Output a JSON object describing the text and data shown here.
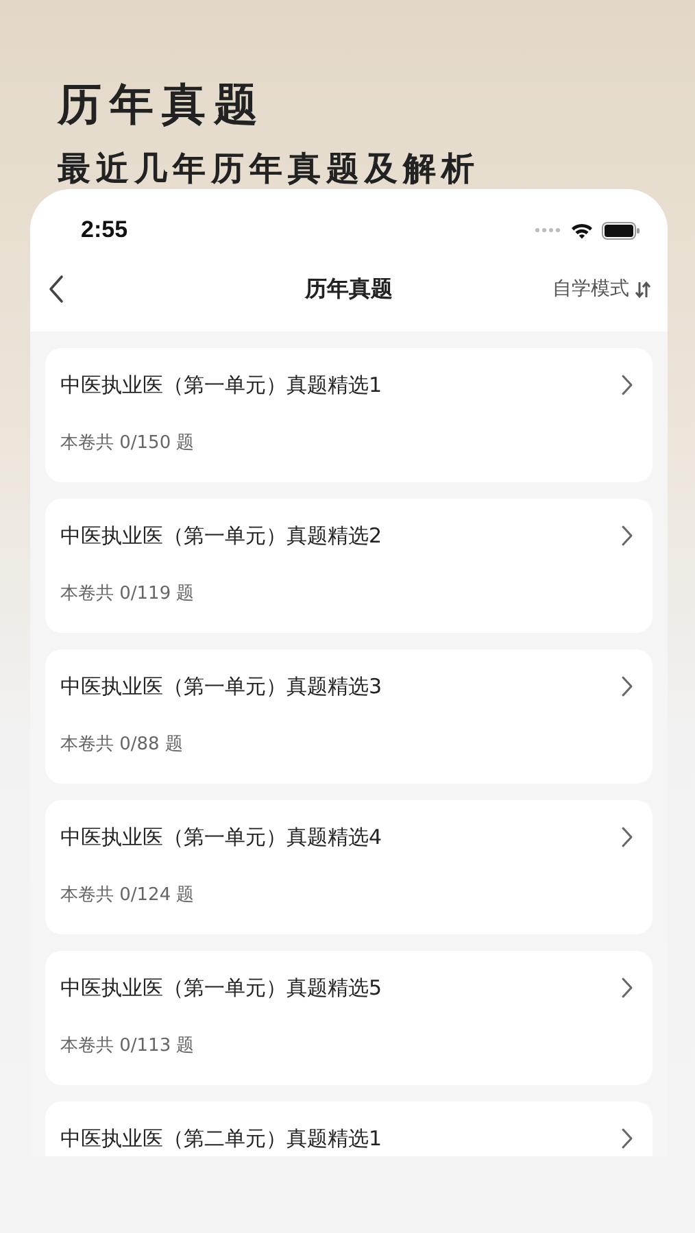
{
  "headline": {
    "title": "历年真题",
    "subtitle": "最近几年历年真题及解析"
  },
  "status_bar": {
    "time": "2:55"
  },
  "nav": {
    "title": "历年真题",
    "mode": "自学模式"
  },
  "papers": [
    {
      "title": "中医执业医（第一单元）真题精选1",
      "count": "本卷共 0/150 题"
    },
    {
      "title": "中医执业医（第一单元）真题精选2",
      "count": "本卷共 0/119 题"
    },
    {
      "title": "中医执业医（第一单元）真题精选3",
      "count": "本卷共 0/88 题"
    },
    {
      "title": "中医执业医（第一单元）真题精选4",
      "count": "本卷共 0/124 题"
    },
    {
      "title": "中医执业医（第一单元）真题精选5",
      "count": "本卷共 0/113 题"
    },
    {
      "title": "中医执业医（第二单元）真题精选1"
    }
  ]
}
